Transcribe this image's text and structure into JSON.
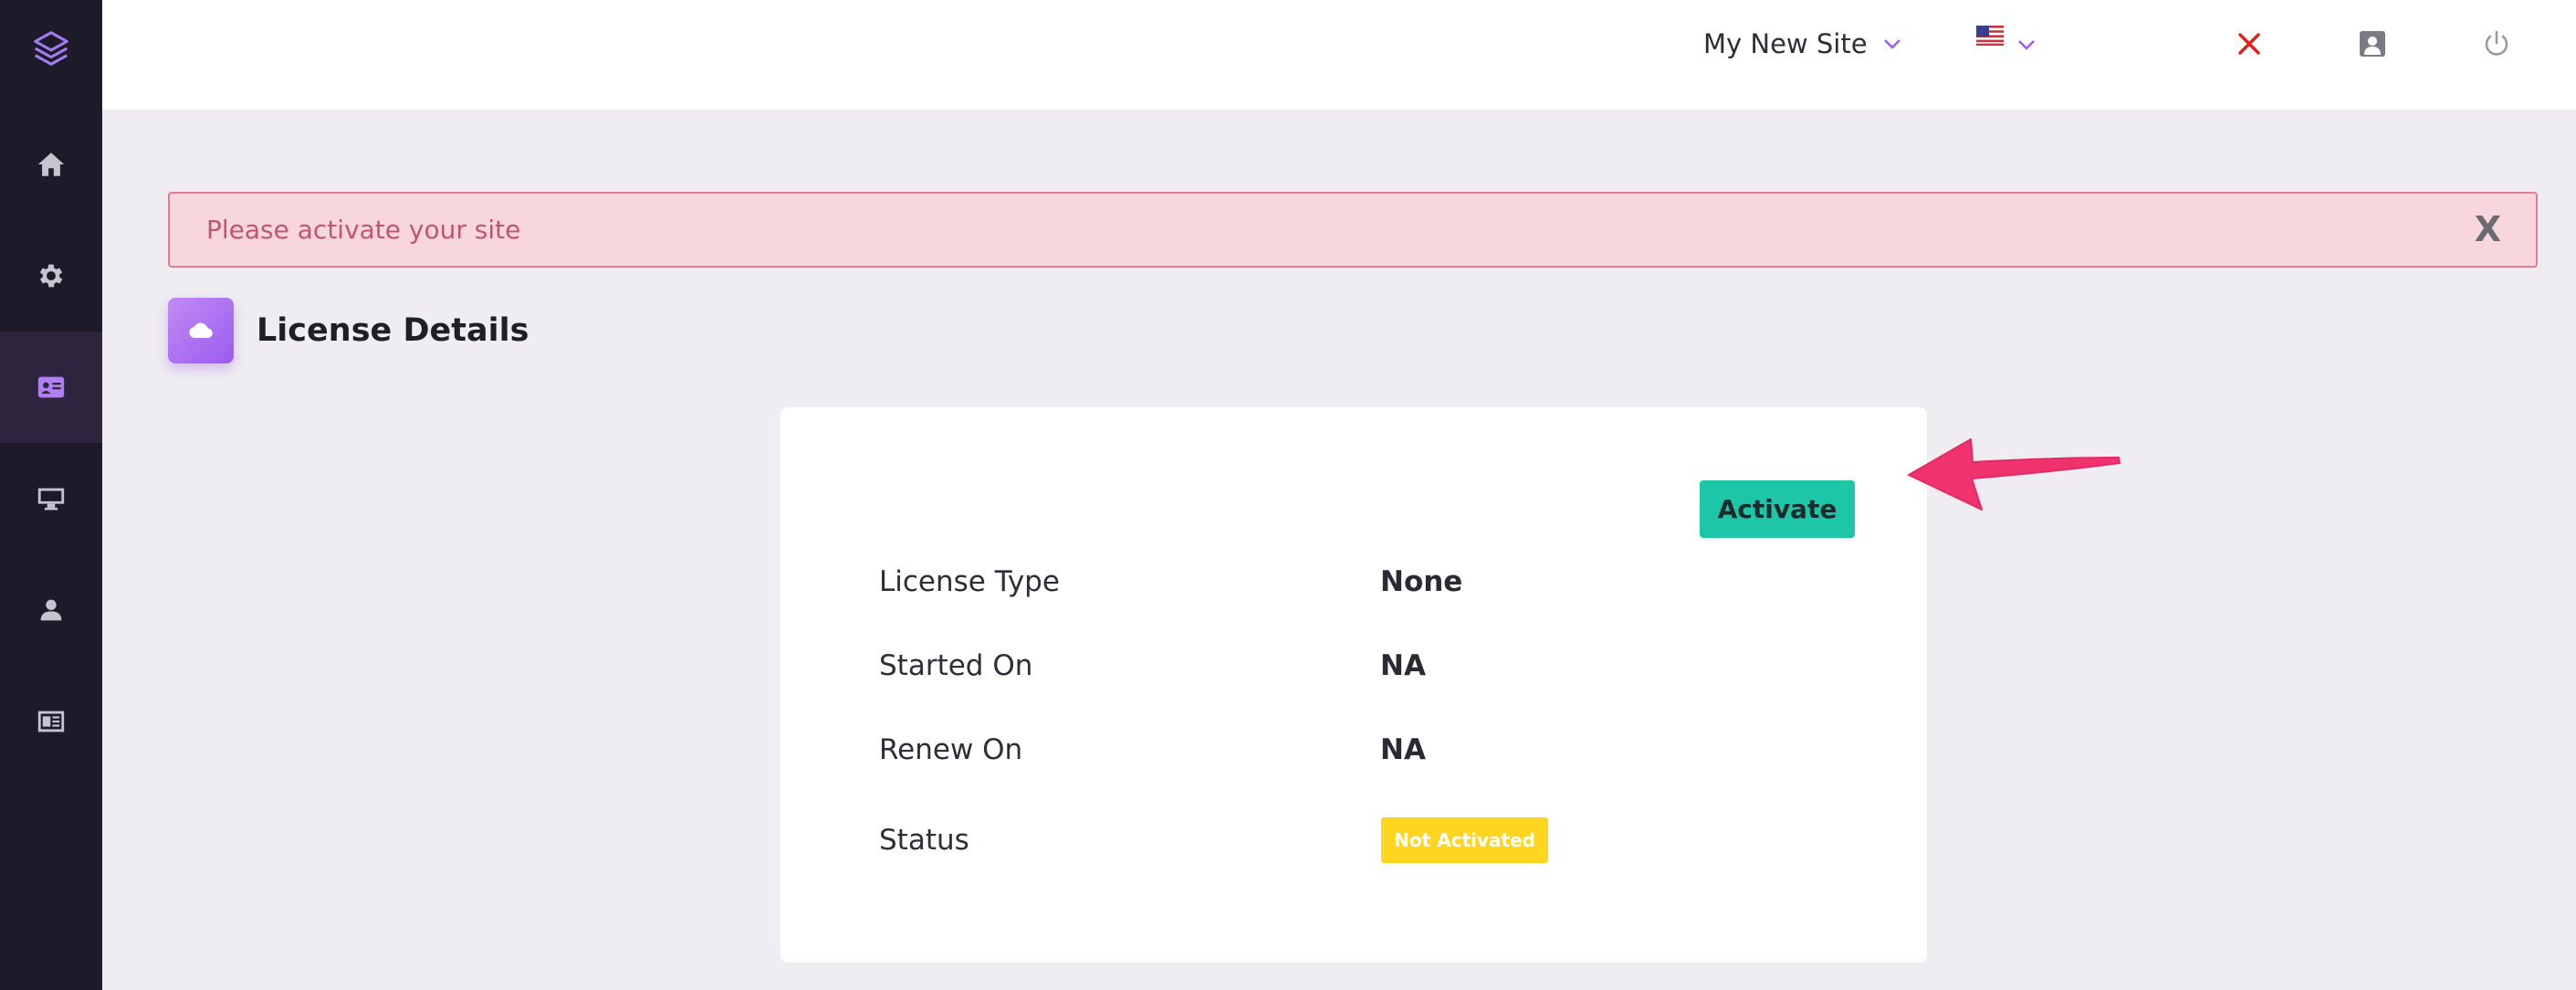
{
  "header": {
    "site_name": "My New Site",
    "language": "us-flag-icon",
    "close_color": "#e0201c"
  },
  "sidebar": {
    "items": [
      {
        "icon": "layers-icon"
      },
      {
        "icon": "home-icon"
      },
      {
        "icon": "gear-icon"
      },
      {
        "icon": "id-card-icon",
        "active": true
      },
      {
        "icon": "monitor-icon"
      },
      {
        "icon": "user-icon"
      },
      {
        "icon": "newspaper-icon"
      }
    ]
  },
  "alert": {
    "message": "Please activate your site",
    "close_label": "X"
  },
  "page": {
    "title": "License Details",
    "icon": "cloud-icon"
  },
  "license": {
    "activate_label": "Activate",
    "rows": [
      {
        "label": "License Type",
        "value": "None"
      },
      {
        "label": "Started On",
        "value": "NA"
      },
      {
        "label": "Renew On",
        "value": "NA"
      },
      {
        "label": "Status",
        "value": "Not Activated"
      }
    ]
  },
  "colors": {
    "accent": "#9a5cf0",
    "activate": "#1ec6a8",
    "status_badge": "#ffd61f",
    "alert_bg": "#f7d6de",
    "arrow": "#f0336e"
  }
}
